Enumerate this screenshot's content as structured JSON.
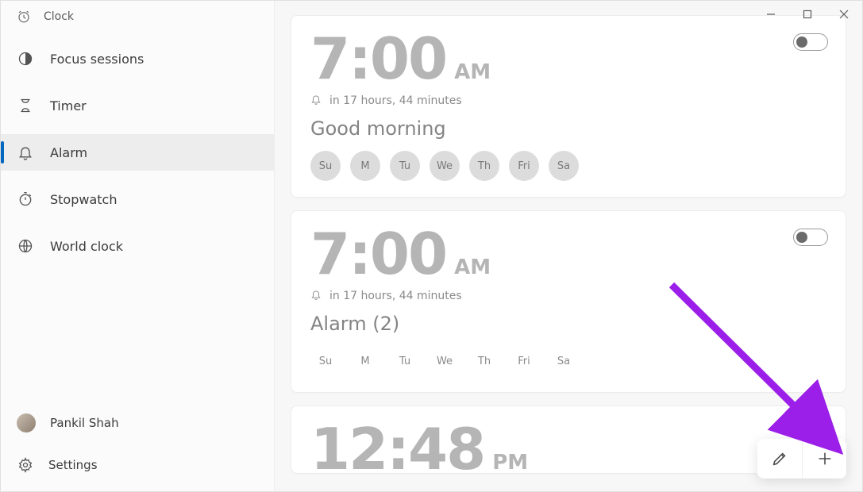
{
  "app": {
    "title": "Clock"
  },
  "nav": {
    "focus": "Focus sessions",
    "timer": "Timer",
    "alarm": "Alarm",
    "stopwatch": "Stopwatch",
    "world": "World clock"
  },
  "user": {
    "name": "Pankil Shah"
  },
  "settings": {
    "label": "Settings"
  },
  "alarms": [
    {
      "time": "7:00",
      "ampm": "AM",
      "countdown": "in 17 hours, 44 minutes",
      "label": "Good morning",
      "days": [
        "Su",
        "M",
        "Tu",
        "We",
        "Th",
        "Fri",
        "Sa"
      ],
      "days_chip": true,
      "enabled": false
    },
    {
      "time": "7:00",
      "ampm": "AM",
      "countdown": "in 17 hours, 44 minutes",
      "label": "Alarm (2)",
      "days": [
        "Su",
        "M",
        "Tu",
        "We",
        "Th",
        "Fri",
        "Sa"
      ],
      "days_chip": false,
      "enabled": false
    },
    {
      "time": "12:48",
      "ampm": "PM",
      "countdown": "",
      "label": "",
      "days": [],
      "days_chip": false,
      "enabled": false
    }
  ]
}
